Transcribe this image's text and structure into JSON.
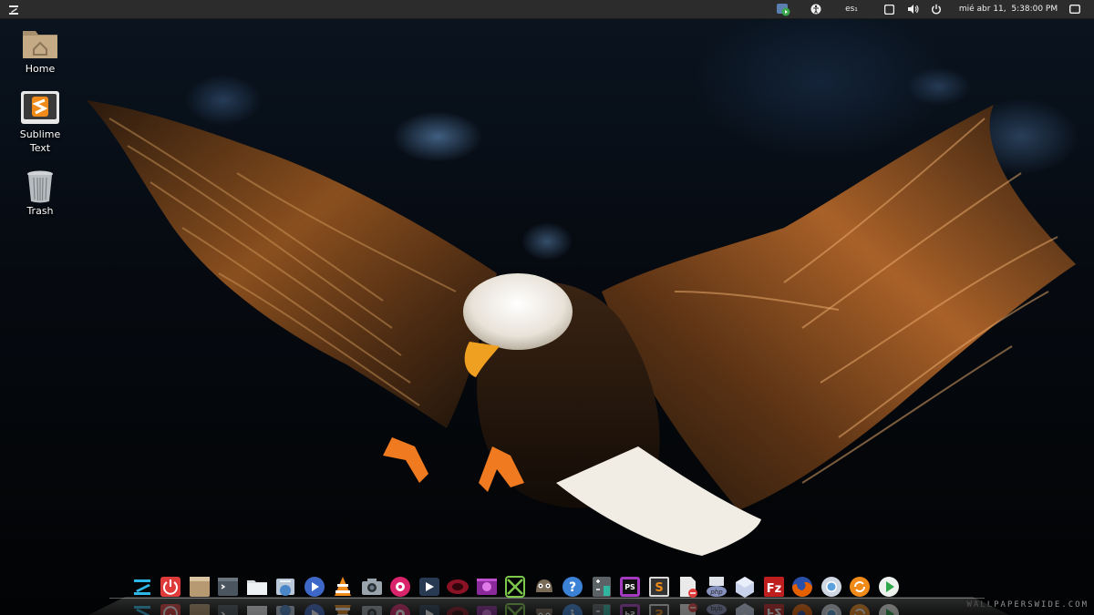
{
  "top_panel": {
    "menu_icon": "zorin-logo-icon",
    "tray": {
      "media_icon": "media-player-icon",
      "accessibility_icon": "accessibility-icon",
      "keyboard_layout": "es₁",
      "workspace_icon": "workspace-icon",
      "volume_icon": "volume-icon",
      "power_icon": "power-icon",
      "datetime": "mié abr 11,  5:38:00 PM",
      "window_icon": "window-icon"
    }
  },
  "desktop_icons": [
    {
      "label": "Home",
      "icon": "home-folder-icon"
    },
    {
      "label": "Sublime Text",
      "icon": "sublime-text-icon"
    },
    {
      "label": "Trash",
      "icon": "trash-icon"
    }
  ],
  "dock": {
    "items": [
      {
        "name": "zorin-menu",
        "color": "#2db8e8"
      },
      {
        "name": "shutdown",
        "color": "#e03b3b"
      },
      {
        "name": "files-manager",
        "color": "#b89a72"
      },
      {
        "name": "terminal",
        "color": "#4a5560"
      },
      {
        "name": "folder",
        "color": "#d7dde3"
      },
      {
        "name": "mail",
        "color": "#b9c8d8"
      },
      {
        "name": "media-player",
        "color": "#3d68c8"
      },
      {
        "name": "vlc",
        "color": "#f08a18"
      },
      {
        "name": "camera",
        "color": "#9aa4ac"
      },
      {
        "name": "music",
        "color": "#d9236b"
      },
      {
        "name": "video-player",
        "color": "#273a52"
      },
      {
        "name": "hardware",
        "color": "#8a1224"
      },
      {
        "name": "video-editor",
        "color": "#8a2a9a"
      },
      {
        "name": "xarchiver",
        "color": "#7cc84a"
      },
      {
        "name": "gimp",
        "color": "#7a6a58"
      },
      {
        "name": "help",
        "color": "#3b82d6"
      },
      {
        "name": "calculator",
        "color": "#5a6266"
      },
      {
        "name": "phpstorm",
        "color": "#a43ac0"
      },
      {
        "name": "sublime-dock",
        "color": "#6b6b6b"
      },
      {
        "name": "text-editor",
        "color": "#eaeaea"
      },
      {
        "name": "php",
        "color": "#8892bf"
      },
      {
        "name": "cube-app",
        "color": "#c8d2ea"
      },
      {
        "name": "filezilla",
        "color": "#bf1e1e"
      },
      {
        "name": "firefox",
        "color": "#e66000"
      },
      {
        "name": "chromium",
        "color": "#5aa0dc"
      },
      {
        "name": "updater",
        "color": "#f08a18"
      },
      {
        "name": "play-store",
        "color": "#2ea84a"
      }
    ]
  },
  "watermark": "WALLPAPERSWIDE.COM"
}
